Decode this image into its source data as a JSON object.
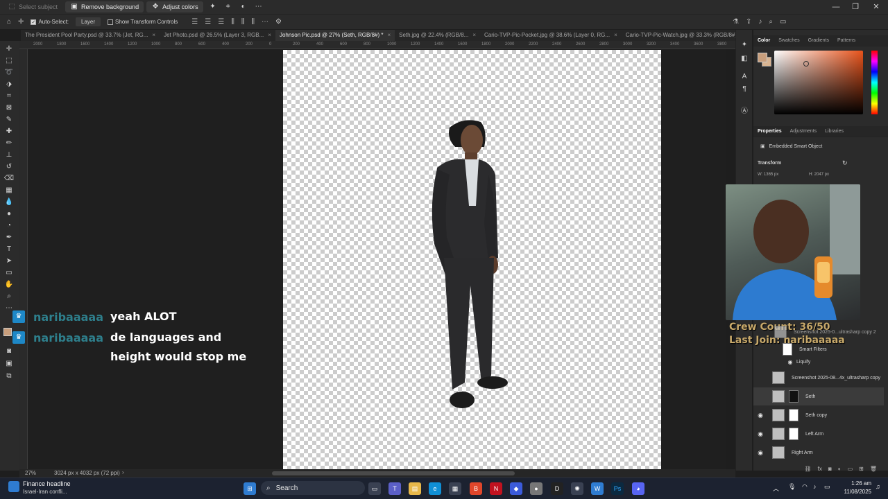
{
  "context_bar": {
    "select_subject": "Select subject",
    "remove_background": "Remove background",
    "adjust_colors": "Adjust colors"
  },
  "options_bar": {
    "auto_select_label": "Auto-Select:",
    "auto_select_value": "Layer",
    "show_transform": "Show Transform Controls"
  },
  "tabs": [
    {
      "label": "The President Pool Party.psd @ 33.7% (Jet, RG...",
      "close": "×"
    },
    {
      "label": "Jet Photo.psd @ 26.5% (Layer 3, RGB...",
      "close": "×"
    },
    {
      "label": "Johnson Pic.psd @ 27% (Seth, RGB/8#) *",
      "close": "×"
    },
    {
      "label": "Seth.jpg @ 22.4% (RGB/8...",
      "close": "×"
    },
    {
      "label": "Cario-TVP-Pic-Pocket.jpg @ 38.6% (Layer 0, RG...",
      "close": "×"
    },
    {
      "label": "Cario-TVP-Pic-Watch.jpg @ 33.3% (RGB/8#)...",
      "close": "×"
    }
  ],
  "ruler": [
    "2000",
    "1800",
    "1600",
    "1400",
    "1200",
    "1000",
    "800",
    "600",
    "400",
    "200",
    "0",
    "200",
    "400",
    "600",
    "800",
    "1000",
    "1200",
    "1400",
    "1600",
    "1800",
    "2000",
    "2200",
    "2400",
    "2600",
    "2800",
    "3000",
    "3200",
    "3400",
    "3600",
    "3800",
    "4000",
    "4200",
    "4400",
    "4600",
    "4800",
    "5000"
  ],
  "chat": [
    {
      "user": "naribaaaaa",
      "message": "yeah ALOT"
    },
    {
      "user": "naribaaaaa",
      "message": "de languages and height would stop me"
    }
  ],
  "status": {
    "zoom": "27%",
    "doc_info": "3024 px x 4032 px (72 ppi)"
  },
  "color_panel": {
    "tabs": [
      "Color",
      "Swatches",
      "Gradients",
      "Patterns"
    ],
    "fg_color": "#c89e7c"
  },
  "properties_panel": {
    "tabs": [
      "Properties",
      "Adjustments",
      "Libraries"
    ],
    "kind": "Embedded Smart Object",
    "transform_label": "Transform",
    "w": "W:  1365 px",
    "h": "H:  2047 px"
  },
  "stream_overlay": {
    "crew_count": "Crew Count: 36/50",
    "last_join": "Last Join: naribaaaaa"
  },
  "layers": [
    {
      "name": "Screenshot 2025-0...ultrasharp copy 2",
      "visible": false,
      "selected": false
    },
    {
      "name": "Smart Filters",
      "visible": false,
      "selected": false
    },
    {
      "name": "Liquify",
      "visible": false,
      "selected": false
    },
    {
      "name": "Screenshot 2025-08...4x_ultrasharp copy",
      "visible": false,
      "selected": false
    },
    {
      "name": "Seth",
      "visible": false,
      "selected": true
    },
    {
      "name": "Seth copy",
      "visible": true,
      "selected": false
    },
    {
      "name": "Left Arm",
      "visible": true,
      "selected": false
    },
    {
      "name": "Right Arm",
      "visible": true,
      "selected": false
    }
  ],
  "taskbar": {
    "news_title": "Finance headline",
    "news_sub": "Israel-Iran confli...",
    "search_placeholder": "Search",
    "time": "1:26 am",
    "date": "11/08/2025"
  }
}
